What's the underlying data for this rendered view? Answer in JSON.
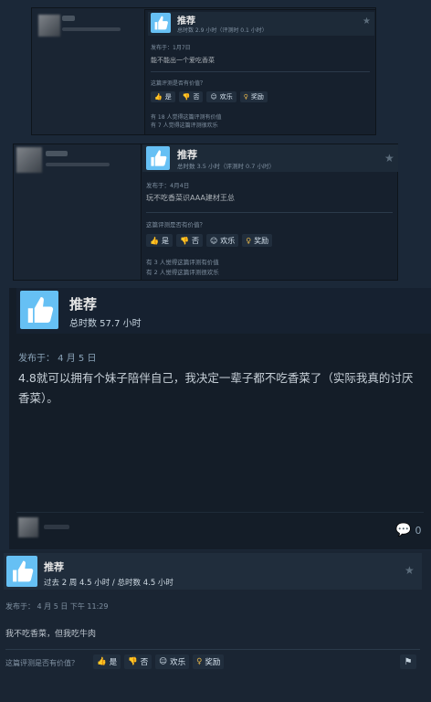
{
  "review1": {
    "title": "推荐",
    "hours": "总时数 2.9 小时（评测时 0.1 小时）",
    "posted": "发布于：1月7日",
    "text": "能不能出一个爱吃香菜",
    "helpful_q": "这篇评测是否有价值？",
    "btn_yes": "是",
    "btn_no": "否",
    "btn_funny": "欢乐",
    "btn_award": "奖励",
    "stat1": "有 18 人觉得这篇评测有价值",
    "stat2": "有 7 人觉得这篇评测很欢乐"
  },
  "review2": {
    "title": "推荐",
    "hours": "总时数 3.5 小时（评测时 0.7 小时）",
    "posted": "发布于：4月4日",
    "text": "玩不吃香菜识AAA建材王总",
    "helpful_q": "这篇评测是否有价值？",
    "btn_yes": "是",
    "btn_no": "否",
    "btn_funny": "欢乐",
    "btn_award": "奖励",
    "stat1": "有 3 人觉得这篇评测有价值",
    "stat2": "有 2 人觉得这篇评测很欢乐"
  },
  "review3": {
    "title": "推荐",
    "hours": "总时数 57.7 小时",
    "posted": "发布于： 4 月 5 日",
    "text": "4.8就可以拥有个妹子陪伴自己，我决定一辈子都不吃香菜了（实际我真的讨厌香菜）。",
    "comments": "0"
  },
  "review4": {
    "title": "推荐",
    "hours": "过去 2 周 4.5 小时 / 总时数 4.5 小时",
    "posted": "发布于： 4 月 5 日 下午 11:29",
    "text": "我不吃香菜，但我吃牛肉",
    "helpful_q": "这篇评测是否有价值？",
    "btn_yes": "是",
    "btn_no": "否",
    "btn_funny": "欢乐",
    "btn_award": "奖励"
  }
}
